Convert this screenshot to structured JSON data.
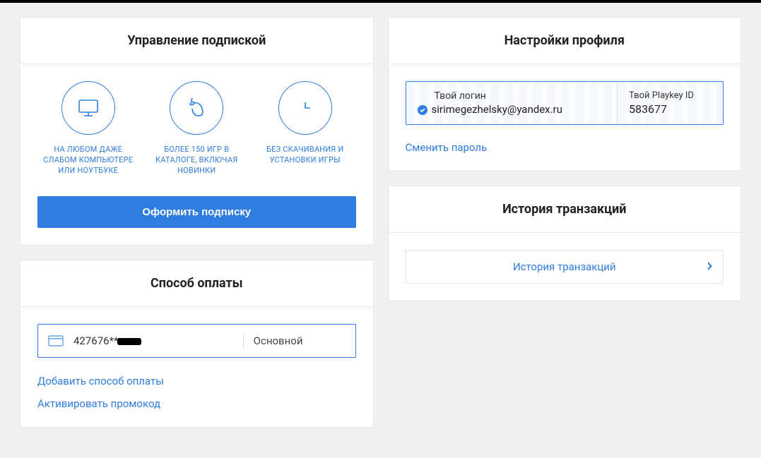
{
  "subscription": {
    "title": "Управление подпиской",
    "features": [
      "НА ЛЮБОМ ДАЖЕ СЛАБОМ КОМПЬЮТЕРЕ ИЛИ НОУТБУКЕ",
      "БОЛЕЕ 150 ИГР В КАТАЛОГЕ, ВКЛЮЧАЯ НОВИНКИ",
      "БЕЗ СКАЧИВАНИЯ И УСТАНОВКИ ИГРЫ"
    ],
    "cta": "Оформить подписку"
  },
  "payment": {
    "title": "Способ оплаты",
    "card_number": "427676**",
    "card_status": "Основной",
    "add_link": "Добавить способ оплаты",
    "promo_link": "Активировать промокод"
  },
  "profile": {
    "title": "Настройки профиля",
    "login_label": "Твой логин",
    "login_value": "sirimegezhelsky@yandex.ru",
    "id_label": "Твой Playkey ID",
    "id_value": "583677",
    "change_password": "Сменить пароль"
  },
  "transactions": {
    "title": "История транзакций",
    "button": "История транзакций"
  }
}
